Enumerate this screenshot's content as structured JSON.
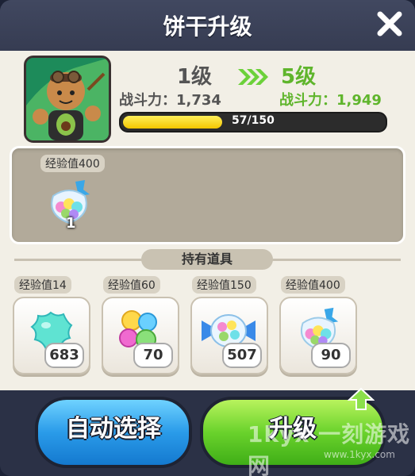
{
  "header": {
    "title": "饼干升级"
  },
  "cookie": {
    "level_from": "1级",
    "power_from": "战斗力：1,734",
    "level_to": "5级",
    "power_to": "战斗力：1,949",
    "xp_text": "57/150",
    "xp_progress": 0.38
  },
  "selected": {
    "xp_label": "经验值400",
    "quantity": "1"
  },
  "inventory": {
    "section_title": "持有道具",
    "items": [
      {
        "xp_label": "经验值14",
        "count": "683",
        "icon": "blue-jelly-icon"
      },
      {
        "xp_label": "经验值60",
        "count": "70",
        "icon": "multicolor-jelly-icon"
      },
      {
        "xp_label": "经验值150",
        "count": "507",
        "icon": "wrapped-jelly-candy-icon"
      },
      {
        "xp_label": "经验值400",
        "count": "90",
        "icon": "jelly-bag-icon"
      }
    ]
  },
  "buttons": {
    "auto_select": "自动选择",
    "upgrade": "升级"
  },
  "watermark": {
    "text": "1kyx 一刻游戏网",
    "url": "www.1kyx.com"
  }
}
